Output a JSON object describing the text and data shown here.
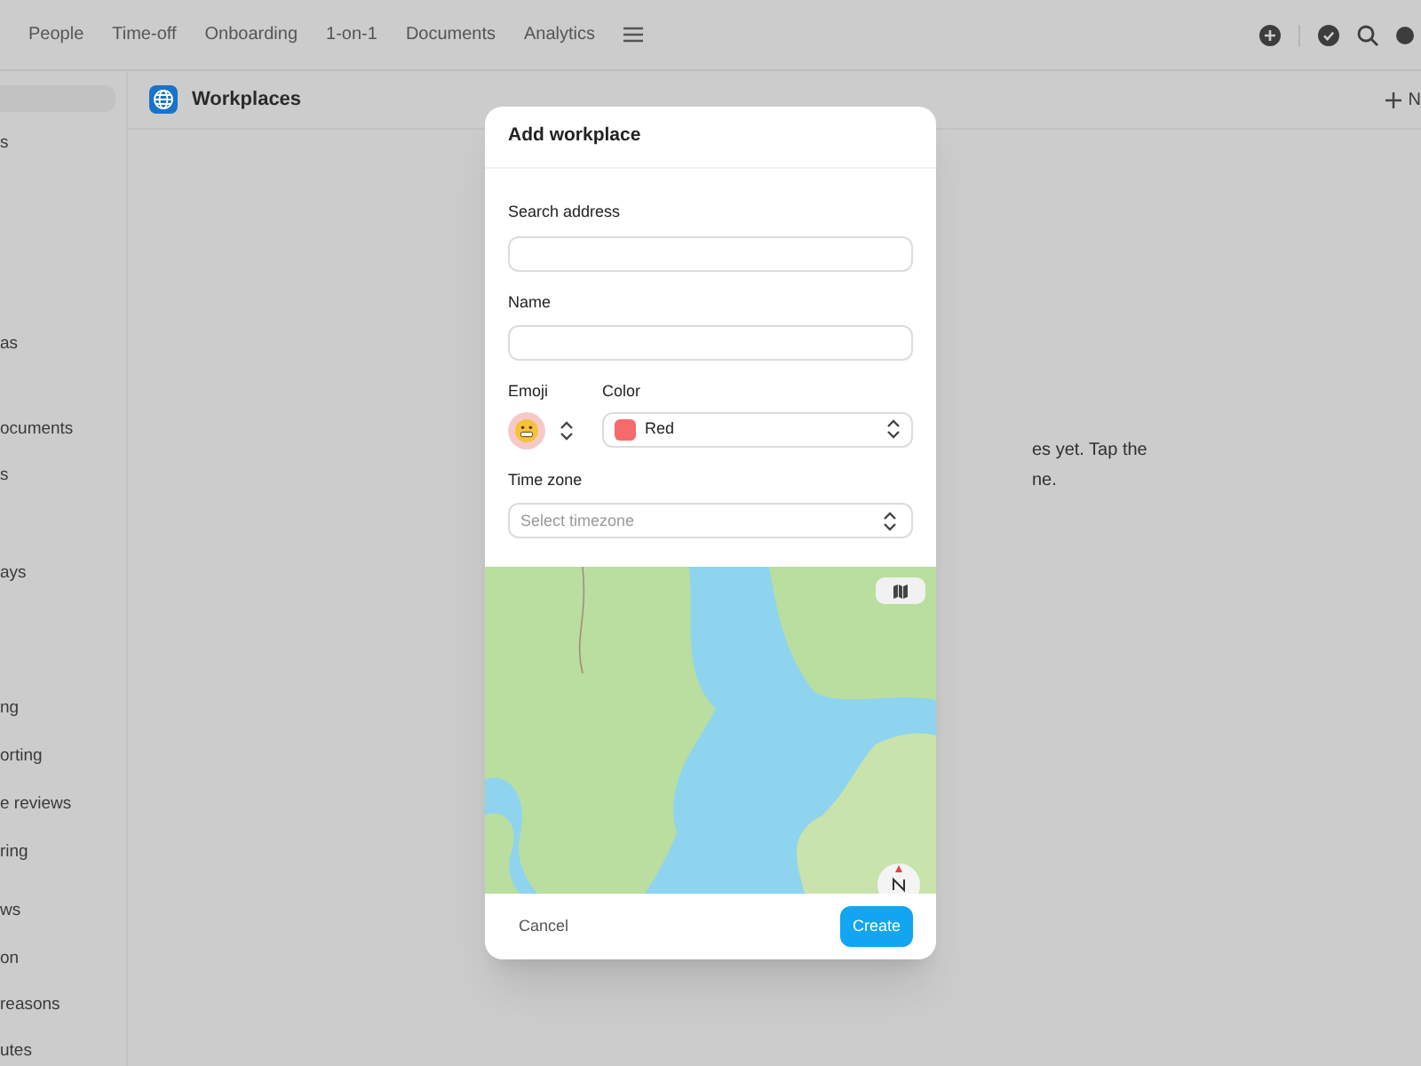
{
  "top_nav": {
    "items": [
      {
        "label": "People"
      },
      {
        "label": "Time-off"
      },
      {
        "label": "Onboarding"
      },
      {
        "label": "1-on-1"
      },
      {
        "label": "Documents"
      },
      {
        "label": "Analytics"
      }
    ]
  },
  "sidebar": {
    "items": [
      {
        "selected": true
      },
      {
        "label": "s",
        "selected": false
      },
      {
        "label": "as",
        "selected": false
      },
      {
        "label": "ocuments",
        "selected": false
      },
      {
        "label": "s",
        "selected": false
      },
      {
        "label": "ays",
        "selected": false
      },
      {
        "label": "ng",
        "selected": false
      },
      {
        "label": "orting",
        "selected": false
      },
      {
        "label": "e reviews",
        "selected": false
      },
      {
        "label": "ring",
        "selected": false
      },
      {
        "label": "ws",
        "selected": false
      },
      {
        "label": "on",
        "selected": false
      },
      {
        "label": "reasons",
        "selected": false
      },
      {
        "label": "utes",
        "selected": false
      }
    ]
  },
  "page_header": {
    "title": "Workplaces",
    "action": "N"
  },
  "empty_state": {
    "lines": [
      "es yet. Tap the",
      "ne."
    ]
  },
  "dialog": {
    "title": "Add workplace",
    "search_address": {
      "label": "Search address"
    },
    "name": {
      "label": "Name"
    },
    "emoji": {
      "label": "Emoji"
    },
    "color": {
      "label": "Color",
      "value": "Red",
      "color": "#f56b6b"
    },
    "time_zone": {
      "label": "Time zone",
      "placeholder": "Select timezone"
    },
    "buttons": {
      "cancel": "Cancel",
      "create": "Create"
    }
  }
}
